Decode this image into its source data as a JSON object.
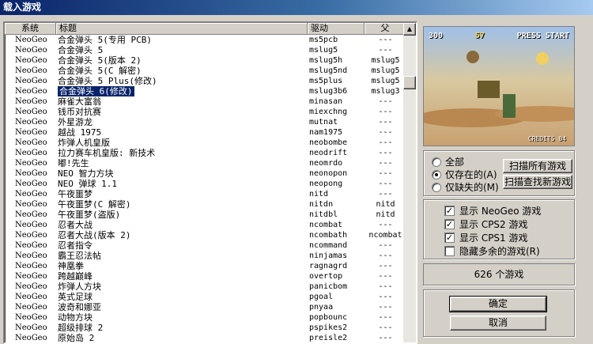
{
  "window": {
    "title": "载入游戏"
  },
  "list": {
    "columns": {
      "system": "系统",
      "title": "标题",
      "driver": "驱动",
      "parent": "父"
    },
    "rows": [
      {
        "system": "NeoGeo",
        "title": "合金弹头 5(专用 PCB)",
        "driver": "ms5pcb",
        "parent": "---"
      },
      {
        "system": "NeoGeo",
        "title": "合金弹头 5",
        "driver": "mslug5",
        "parent": "---"
      },
      {
        "system": "NeoGeo",
        "title": "合金弹头 5(版本 2)",
        "driver": "mslug5h",
        "parent": "mslug5"
      },
      {
        "system": "NeoGeo",
        "title": "合金弹头 5(C 解密)",
        "driver": "mslug5nd",
        "parent": "mslug5"
      },
      {
        "system": "NeoGeo",
        "title": "合金弹头 5 Plus(修改)",
        "driver": "ms5plus",
        "parent": "mslug5"
      },
      {
        "system": "NeoGeo",
        "title": "合金弹头 6(修改)",
        "driver": "mslug3b6",
        "parent": "mslug3",
        "selected": true
      },
      {
        "system": "NeoGeo",
        "title": "麻雀大富翁",
        "driver": "minasan",
        "parent": "---"
      },
      {
        "system": "NeoGeo",
        "title": "钱币对抗赛",
        "driver": "miexchng",
        "parent": "---"
      },
      {
        "system": "NeoGeo",
        "title": "外星游龙",
        "driver": "mutnat",
        "parent": "---"
      },
      {
        "system": "NeoGeo",
        "title": "越战 1975",
        "driver": "nam1975",
        "parent": "---"
      },
      {
        "system": "NeoGeo",
        "title": "炸弹人机皇版",
        "driver": "neobombe",
        "parent": "---"
      },
      {
        "system": "NeoGeo",
        "title": "拉力赛车机皇版: 新技术",
        "driver": "neodrift",
        "parent": "---"
      },
      {
        "system": "NeoGeo",
        "title": "嘟!先生",
        "driver": "neomrdo",
        "parent": "---"
      },
      {
        "system": "NeoGeo",
        "title": "NEO 智力方块",
        "driver": "neonopon",
        "parent": "---"
      },
      {
        "system": "NeoGeo",
        "title": "NEO 弹球 1.1",
        "driver": "neopong",
        "parent": "---"
      },
      {
        "system": "NeoGeo",
        "title": "午夜噩梦",
        "driver": "nitd",
        "parent": "---"
      },
      {
        "system": "NeoGeo",
        "title": "午夜噩梦(C 解密)",
        "driver": "nitdn",
        "parent": "nitd"
      },
      {
        "system": "NeoGeo",
        "title": "午夜噩梦(盗版)",
        "driver": "nitdbl",
        "parent": "nitd"
      },
      {
        "system": "NeoGeo",
        "title": "忍者大战",
        "driver": "ncombat",
        "parent": "---"
      },
      {
        "system": "NeoGeo",
        "title": "忍者大战(版本 2)",
        "driver": "ncombath",
        "parent": "ncombat"
      },
      {
        "system": "NeoGeo",
        "title": "忍者指令",
        "driver": "ncommand",
        "parent": "---"
      },
      {
        "system": "NeoGeo",
        "title": "霸王忍法帖",
        "driver": "ninjamas",
        "parent": "---"
      },
      {
        "system": "NeoGeo",
        "title": "神凰拳",
        "driver": "ragnagrd",
        "parent": "---"
      },
      {
        "system": "NeoGeo",
        "title": "跨越巅峰",
        "driver": "overtop",
        "parent": "---"
      },
      {
        "system": "NeoGeo",
        "title": "炸弹人方块",
        "driver": "panicbom",
        "parent": "---"
      },
      {
        "system": "NeoGeo",
        "title": "英式足球",
        "driver": "pgoal",
        "parent": "---"
      },
      {
        "system": "NeoGeo",
        "title": "波奇和娜亚",
        "driver": "pnyaa",
        "parent": "---"
      },
      {
        "system": "NeoGeo",
        "title": "动物方块",
        "driver": "popbounc",
        "parent": "---"
      },
      {
        "system": "NeoGeo",
        "title": "超级排球 2",
        "driver": "pspikes2",
        "parent": "---"
      },
      {
        "system": "NeoGeo",
        "title": "原始岛 2",
        "driver": "preisle2",
        "parent": "---"
      }
    ]
  },
  "preview": {
    "hud_left": "300",
    "hud_mid": "57",
    "hud_right": "PRESS START",
    "credits": "CREDITS 04"
  },
  "filter": {
    "all": "全部",
    "available": "仅存在的(A)",
    "missing": "仅缺失的(M)",
    "selected": "available",
    "scan_all": "扫描所有游戏",
    "scan_new": "扫描查找新游戏"
  },
  "show": [
    {
      "label": "显示 NeoGeo 游戏",
      "checked": true
    },
    {
      "label": "显示 CPS2 游戏",
      "checked": true
    },
    {
      "label": "显示 CPS1 游戏",
      "checked": true
    },
    {
      "label": "隐藏多余的游戏(R)",
      "checked": false
    }
  ],
  "count_text": "626 个游戏",
  "ok": "确定",
  "cancel": "取消"
}
